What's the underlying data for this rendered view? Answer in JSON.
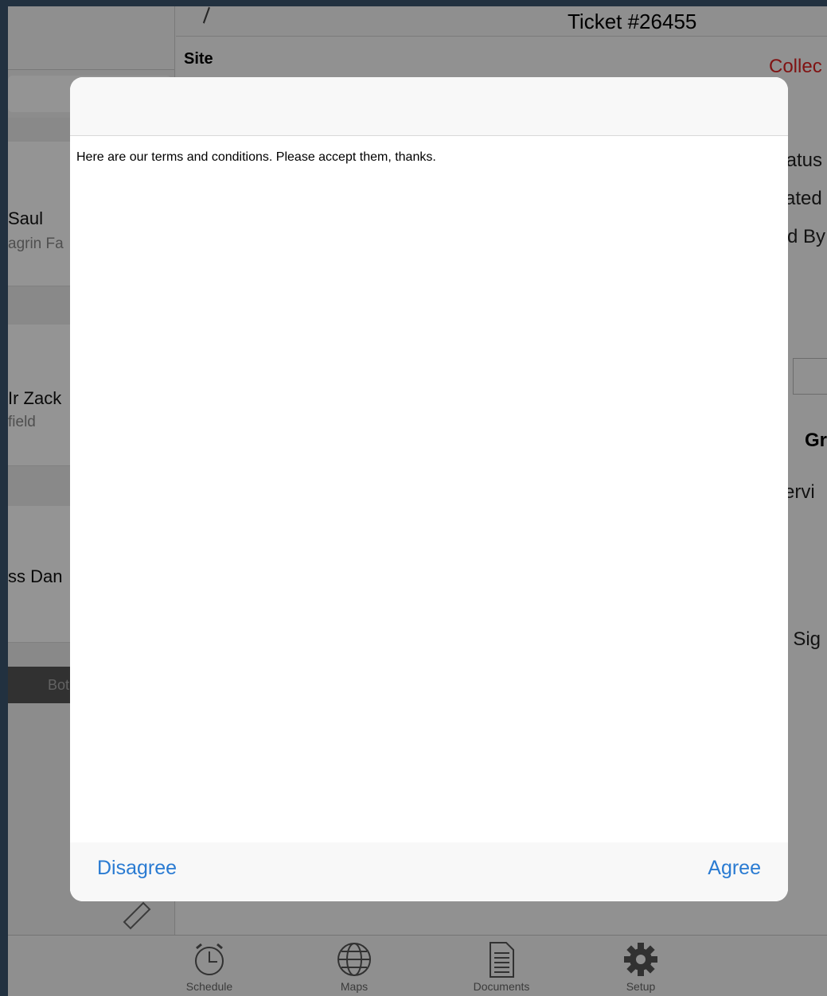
{
  "header": {
    "ticket_title": "Ticket #26455",
    "site_label": "Site",
    "collect_label": "Collec"
  },
  "list": {
    "rows": [
      {
        "name": "Saul",
        "sub": "agrin Fa"
      },
      {
        "name": "Ir Zack",
        "sub": "field"
      },
      {
        "name": "ss Dan",
        "sub": ""
      }
    ],
    "segment_label": "Both"
  },
  "details": {
    "status": "tatus",
    "created": "ated",
    "by": "d By",
    "group": "Gr",
    "service": "ervi",
    "signature": "t Sig"
  },
  "tabs": [
    {
      "label": "Schedule",
      "icon": "alarm-clock-icon"
    },
    {
      "label": "Maps",
      "icon": "globe-icon"
    },
    {
      "label": "Documents",
      "icon": "document-icon"
    },
    {
      "label": "Setup",
      "icon": "gear-icon"
    }
  ],
  "modal": {
    "body_text": "Here are our terms and conditions. Please accept them, thanks.",
    "disagree_label": "Disagree",
    "agree_label": "Agree"
  },
  "colors": {
    "accent": "#2a7bd2",
    "alert": "#dd2222"
  }
}
